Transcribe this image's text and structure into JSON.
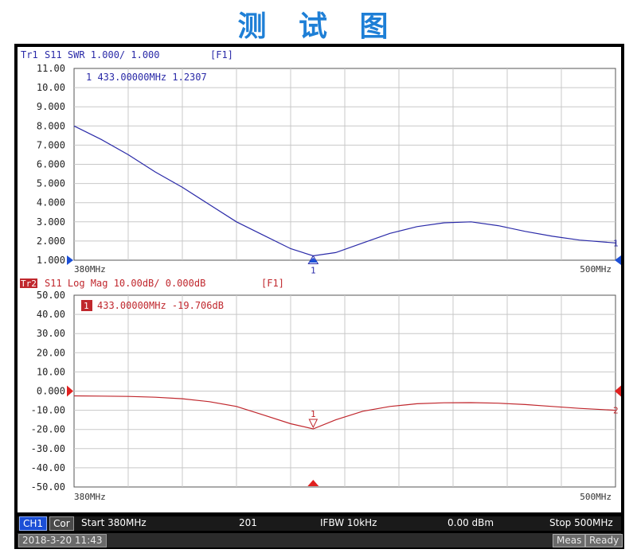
{
  "page_title": "测 试 图",
  "trace1": {
    "header_tr": "Tr1",
    "header_rest": "S11  SWR 1.000/ 1.000",
    "header_fkey": "[F1]",
    "marker_readout": "1  433.00000MHz  1.2307",
    "y_ticks": [
      "11.00",
      "10.00",
      "9.000",
      "8.000",
      "7.000",
      "6.000",
      "5.000",
      "4.000",
      "3.000",
      "2.000",
      "1.000"
    ],
    "x_start_label": "380MHz",
    "x_stop_label": "500MHz",
    "marker_label": "1",
    "end_label": "1",
    "color": "#2a2aa8"
  },
  "trace2": {
    "header_tr": "Tr2",
    "header_rest": "S11  Log Mag 10.00dB/ 0.000dB",
    "header_fkey": "[F1]",
    "marker_box": "1",
    "marker_readout": "433.00000MHz  -19.706dB",
    "y_ticks": [
      "50.00",
      "40.00",
      "30.00",
      "20.00",
      "10.00",
      "0.000",
      "-10.00",
      "-20.00",
      "-30.00",
      "-40.00",
      "-50.00"
    ],
    "x_start_label": "380MHz",
    "x_stop_label": "500MHz",
    "marker_label": "1",
    "end_label": "2",
    "color": "#c0272d"
  },
  "status": {
    "ch": "CH1",
    "cor": "Cor",
    "start": "Start 380MHz",
    "points": "201",
    "ifbw": "IFBW 10kHz",
    "power": "0.00 dBm",
    "stop": "Stop 500MHz"
  },
  "bottom": {
    "datetime": "2018-3-20 11:43",
    "meas": "Meas",
    "ready": "Ready"
  },
  "chart_data": [
    {
      "type": "line",
      "title": "",
      "xlabel": "",
      "ylabel": "",
      "xlim": [
        380,
        500
      ],
      "ylim": [
        1,
        11
      ],
      "grid": true,
      "series": [
        {
          "x": [
            380,
            386,
            392,
            398,
            404,
            410,
            416,
            422,
            428,
            433,
            438,
            444,
            450,
            456,
            462,
            468,
            474,
            480,
            486,
            492,
            500
          ],
          "y": [
            8.0,
            7.3,
            6.5,
            5.6,
            4.8,
            3.9,
            3.0,
            2.3,
            1.6,
            1.23,
            1.4,
            1.9,
            2.4,
            2.75,
            2.95,
            3.0,
            2.8,
            2.5,
            2.25,
            2.05,
            1.9
          ]
        }
      ],
      "marker": {
        "x": 433,
        "y": 1.2307
      }
    },
    {
      "type": "line",
      "title": "",
      "xlabel": "",
      "ylabel": "",
      "xlim": [
        380,
        500
      ],
      "ylim": [
        -50,
        50
      ],
      "grid": true,
      "series": [
        {
          "x": [
            380,
            386,
            392,
            398,
            404,
            410,
            416,
            422,
            428,
            433,
            438,
            444,
            450,
            456,
            462,
            468,
            474,
            480,
            486,
            492,
            500
          ],
          "y": [
            -2.5,
            -2.6,
            -2.8,
            -3.2,
            -4.0,
            -5.5,
            -8.0,
            -12.5,
            -17.0,
            -19.706,
            -15.0,
            -10.5,
            -8.0,
            -6.6,
            -6.1,
            -6.0,
            -6.3,
            -7.0,
            -8.0,
            -9.0,
            -10.0
          ]
        }
      ],
      "marker": {
        "x": 433,
        "y": -19.706
      }
    }
  ]
}
